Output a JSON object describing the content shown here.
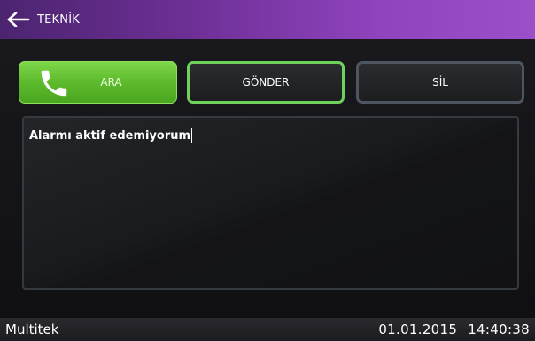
{
  "header": {
    "title": "TEKNİK",
    "back_icon": "arrow-left-icon"
  },
  "actions": {
    "call_label": "ARA",
    "call_icon": "phone-icon",
    "send_label": "GÖNDER",
    "delete_label": "SİL"
  },
  "message": {
    "value": "Alarmı aktif edemiyorum"
  },
  "status_bar": {
    "brand": "Multitek",
    "date": "01.01.2015",
    "time": "14:40:38"
  },
  "colors": {
    "header_gradient_start": "#4b2470",
    "header_gradient_end": "#9b4fc8",
    "call_green": "#5fbd2e",
    "send_border": "#6fd05c",
    "delete_border": "#4c5560"
  }
}
